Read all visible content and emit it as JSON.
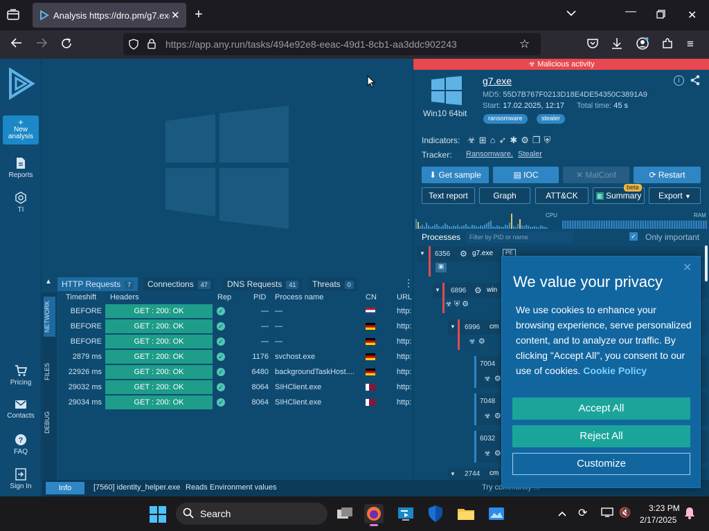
{
  "browser": {
    "tab_title": "Analysis https://dro.pm/g7.exe",
    "url": "https://app.any.run/tasks/494e92e8-eeac-49d1-8cb1-aa3ddc902243"
  },
  "leftnav": {
    "new_analysis": "New analysis",
    "items": [
      "Reports",
      "TI",
      "Pricing",
      "Contacts",
      "FAQ",
      "Sign In"
    ]
  },
  "network": {
    "tabs": [
      {
        "label": "HTTP Requests",
        "count": "7"
      },
      {
        "label": "Connections",
        "count": "47"
      },
      {
        "label": "DNS Requests",
        "count": "41"
      },
      {
        "label": "Threats",
        "count": "0"
      }
    ],
    "columns": [
      "Timeshift",
      "Headers",
      "Rep",
      "PID",
      "Process name",
      "CN",
      "URL"
    ],
    "rows": [
      {
        "time": "BEFORE",
        "header": "GET : 200: OK",
        "pid": "—",
        "proc": "—",
        "flag": "nl",
        "url": "http:"
      },
      {
        "time": "BEFORE",
        "header": "GET : 200: OK",
        "pid": "—",
        "proc": "—",
        "flag": "de",
        "url": "http:"
      },
      {
        "time": "BEFORE",
        "header": "GET : 200: OK",
        "pid": "—",
        "proc": "—",
        "flag": "de",
        "url": "http:"
      },
      {
        "time": "2879 ms",
        "header": "GET : 200: OK",
        "pid": "1176",
        "proc": "svchost.exe",
        "flag": "de",
        "url": "http:"
      },
      {
        "time": "22926 ms",
        "header": "GET : 200: OK",
        "pid": "6480",
        "proc": "backgroundTaskHost....",
        "flag": "de",
        "url": "http:"
      },
      {
        "time": "29032 ms",
        "header": "GET : 200: OK",
        "pid": "8064",
        "proc": "SIHClient.exe",
        "flag": "qa",
        "url": "http:"
      },
      {
        "time": "29034 ms",
        "header": "GET : 200: OK",
        "pid": "8064",
        "proc": "SIHClient.exe",
        "flag": "qa",
        "url": "http:"
      }
    ],
    "vtabs": [
      "NETWORK",
      "FILES",
      "DEBUG"
    ]
  },
  "status": {
    "info_label": "Info",
    "message_proc": "[7560] identity_helper.exe",
    "message_text": "Reads Environment values"
  },
  "task": {
    "verdict": "Malicious activity",
    "os": "Win10 64bit",
    "filename": "g7.exe",
    "md5_label": "MD5:",
    "md5": "55D7B767F0213D18E4DE54350C3891A9",
    "start_label": "Start:",
    "start": "17.02.2025, 12:17",
    "total_label": "Total time:",
    "total": "45 s",
    "tags": [
      "ransomware",
      "stealer"
    ],
    "indicators_label": "Indicators:",
    "tracker_label": "Tracker:",
    "trackers": [
      "Ransomware,",
      "Stealer"
    ],
    "buttons": [
      "Get sample",
      "IOC",
      "MalConf",
      "Restart"
    ],
    "buttons2": [
      "Text report",
      "Graph",
      "ATT&CK",
      "Summary",
      "Export"
    ],
    "beta": "beta",
    "cpu": "CPU",
    "ram": "RAM"
  },
  "processes": {
    "title": "Processes",
    "filter_placeholder": "Filter by PID or name",
    "only_important": "Only important",
    "items": [
      {
        "pid": "6356",
        "name": "g7.exe",
        "badge": "PE"
      },
      {
        "pid": "6896",
        "name": "win"
      },
      {
        "pid": "6996",
        "name": "cm"
      },
      {
        "pid": "7004",
        "name": ""
      },
      {
        "pid": "7048",
        "name": ""
      },
      {
        "pid": "6032",
        "name": ""
      },
      {
        "pid": "2744",
        "name": "cm"
      }
    ]
  },
  "cookie": {
    "title": "We value your privacy",
    "body": "We use cookies to enhance your browsing experience, serve personalized content, and to analyze our traffic. By clicking \"Accept All\", you consent to our use of cookies.",
    "policy_link": "Cookie Policy",
    "accept": "Accept All",
    "reject": "Reject All",
    "customize": "Customize"
  },
  "bottom_hint": "Try community ...",
  "taskbar": {
    "search": "Search",
    "time": "3:23 PM",
    "date": "2/17/2025"
  },
  "colors": {
    "app_bg": "#0e4a70",
    "accent_teal": "#1e9d8a",
    "danger": "#e8484f",
    "cookie_btn": "#1ba59a"
  }
}
